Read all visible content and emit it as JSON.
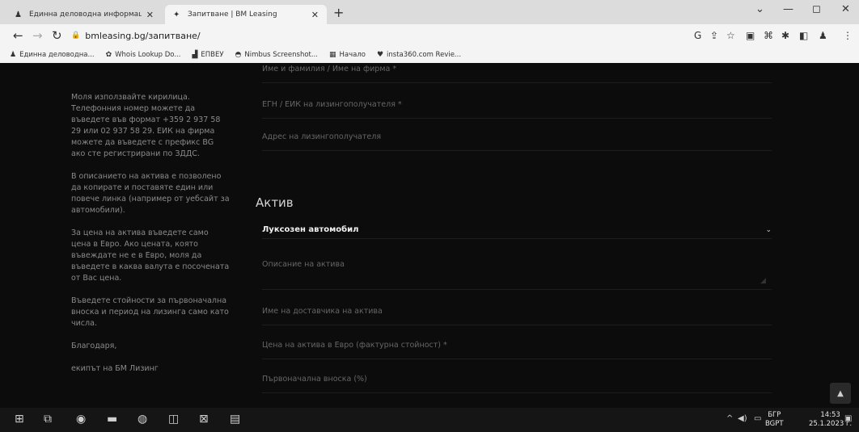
{
  "browser": {
    "tabs": [
      {
        "label": "Единна деловодна информац",
        "icon": "person-icon",
        "active": false
      },
      {
        "label": "Запитване | BM Leasing",
        "icon": "bm-logo-icon",
        "active": true
      }
    ],
    "new_tab": "+",
    "window_controls": {
      "dropdown": "⌄",
      "minimize": "—",
      "maximize": "◻",
      "close": "✕"
    },
    "url": "bmleasing.bg/запитване/",
    "bookmarks": [
      {
        "label": "Единна деловодна...",
        "icon": "person-icon"
      },
      {
        "label": "Whois Lookup Do...",
        "icon": "gear-icon"
      },
      {
        "label": "ЕПВЕУ",
        "icon": "chart-icon"
      },
      {
        "label": "Nimbus Screenshot...",
        "icon": "nimbus-icon"
      },
      {
        "label": "Начало",
        "icon": "grid-icon"
      },
      {
        "label": "insta360.com Revie...",
        "icon": "heart-shield-icon"
      }
    ]
  },
  "sidebar": {
    "paragraphs": [
      "Моля използвайте кирилица. Телефонния номер можете да въведете във формат +359 2 937 58 29 или 02 937 58 29. ЕИК на фирма можете да въведете с префикс BG ако сте регистрирани по ЗДДС.",
      "В описанието на актива е позволено да копирате и поставяте един или повече линка (например от уебсайт за автомобили).",
      "За цена на актива въведете само цена в Евро. Ако цената, която въвеждате не е в Евро, моля да въведете в каква валута е посочената от Вас цена.",
      "Въведете стойности за първоначална вноска и период на лизинга само като числа.",
      "Благодаря,",
      "екипът на БМ Лизинг"
    ]
  },
  "form": {
    "top_fields": [
      {
        "placeholder": "Име и фамилия / Име на фирма *"
      },
      {
        "placeholder": "ЕГН / ЕИК на лизингополучателя *"
      },
      {
        "placeholder": "Адрес на лизингополучателя"
      }
    ],
    "section_title": "Актив",
    "asset_type": "Луксозен автомобил",
    "asset_fields": [
      {
        "placeholder": "Описание на актива"
      },
      {
        "placeholder": "Име на доставчика на актива"
      },
      {
        "placeholder": "Цена на актива в Евро (фактурна стойност) *"
      },
      {
        "placeholder": "Първоначална вноска (%)"
      }
    ]
  },
  "taskbar": {
    "language": "БГР",
    "language_sub": "BGPT",
    "time": "14:53",
    "date": "25.1.2023 г."
  }
}
